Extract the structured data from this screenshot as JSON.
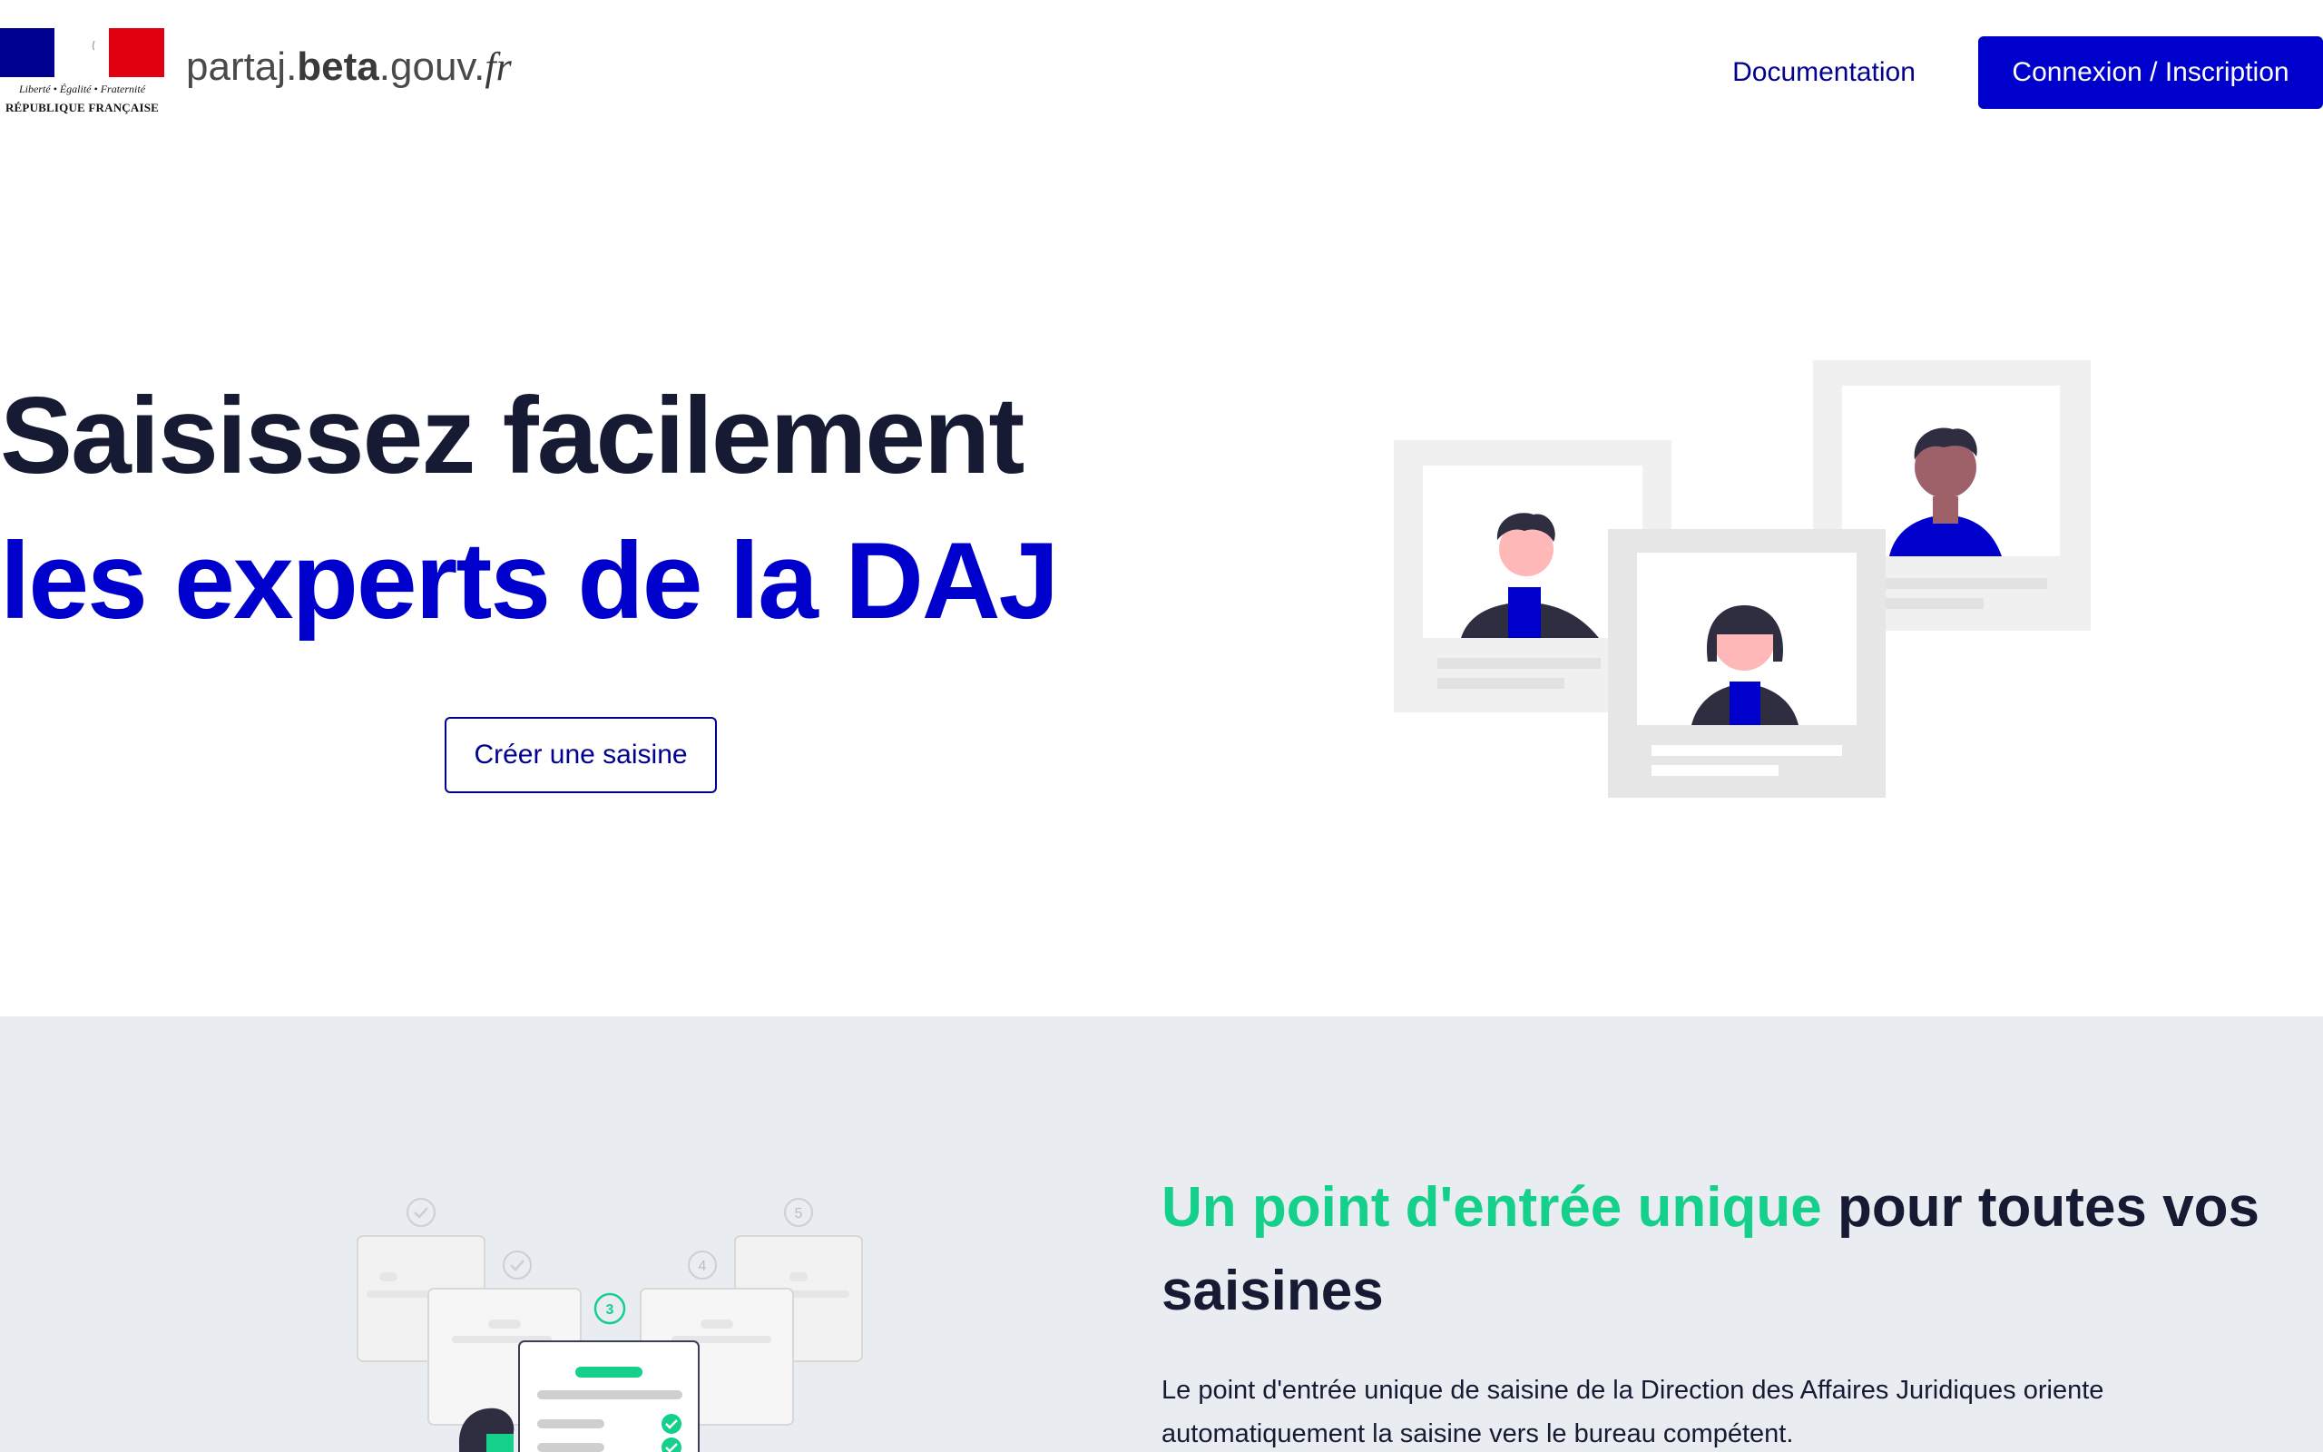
{
  "header": {
    "logo": {
      "motto": "Liberté • Égalité • Fraternité",
      "institution": "RÉPUBLIQUE FRANÇAISE"
    },
    "brand": {
      "part1": "partaj.",
      "part2": "beta",
      "part3": ".gouv.",
      "part4": "fr"
    },
    "nav": {
      "documentation": "Documentation",
      "login": "Connexion / Inscription"
    }
  },
  "hero": {
    "title_line1": "Saisissez facilement",
    "title_line2": "les experts de la DAJ",
    "cta": "Créer une saisine"
  },
  "section2": {
    "title_accent": "Un point d'entrée unique",
    "title_rest": " pour toutes vos saisines",
    "description": "Le point d'entrée unique de saisine de la Direction des Affaires Juridiques oriente automatiquement la saisine vers le bureau compétent.",
    "steps": [
      "3",
      "4",
      "5"
    ]
  },
  "colors": {
    "primary": "#0000cc",
    "primary_dark": "#000091",
    "text": "#161b33",
    "accent_green": "#15d08a",
    "section_bg": "#e9ecf1",
    "flag_blue": "#000091",
    "flag_red": "#e1000f"
  }
}
